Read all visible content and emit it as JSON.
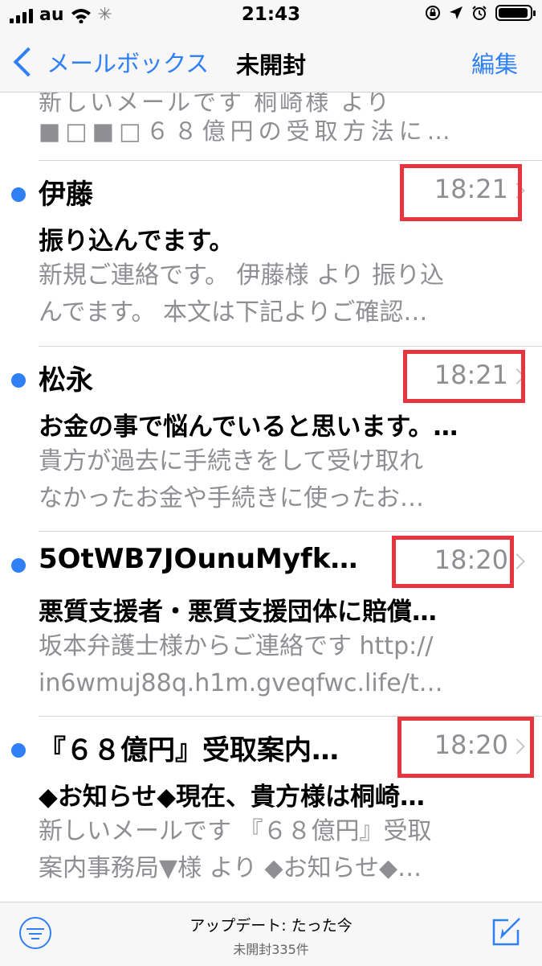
{
  "status_bar": {
    "carrier": "au",
    "time": "21:43"
  },
  "nav": {
    "back_label": "メールボックス",
    "title": "未開封",
    "edit_label": "編集"
  },
  "partial_item": {
    "line1": "新しいメールです 桐崎様 より",
    "line2": "■□■□６８億円の受取方法に…"
  },
  "emails": [
    {
      "sender": "伊藤",
      "time": "18:21",
      "subject": "振り込んでます。",
      "preview1": "新規ご連絡です。 伊藤様 より 振り込",
      "preview2": "んでます。 本文は下記よりご確認…",
      "unread": true
    },
    {
      "sender": "松永",
      "time": "18:21",
      "subject": "お金の事で悩んでいると思います。…",
      "preview1": "貴方が過去に手続きをして受け取れ",
      "preview2": "なかったお金や手続きに使ったお…",
      "unread": true
    },
    {
      "sender": "5OtWB7JOunuMyfk…",
      "time": "18:20",
      "subject": "悪質支援者・悪質支援団体に賠償…",
      "preview1": "坂本弁護士様からご連絡です http://",
      "preview2": "in6wmuj88q.h1m.gveqfwc.life/t…",
      "unread": true
    },
    {
      "sender": "『６８億円』受取案内…",
      "time": "18:20",
      "subject": "◆お知らせ◆現在、貴方様は桐崎…",
      "preview1": "新しいメールです 『６８億円』受取",
      "preview2": "案内事務局▼様 より ◆お知らせ◆…",
      "unread": true
    }
  ],
  "toolbar": {
    "update_text": "アップデート: たった今",
    "unread_count": "未開封335件"
  },
  "colors": {
    "accent": "#2f7ff5",
    "highlight": "#e8343f",
    "secondary_text": "#8e8e93"
  },
  "icons": [
    "signal-icon",
    "wifi-icon",
    "loading-spinner-icon",
    "lock-rotation-icon",
    "location-arrow-icon",
    "alarm-icon",
    "battery-icon",
    "back-chevron-icon",
    "unread-dot-icon",
    "disclosure-chevron-icon",
    "filter-icon",
    "compose-icon"
  ]
}
